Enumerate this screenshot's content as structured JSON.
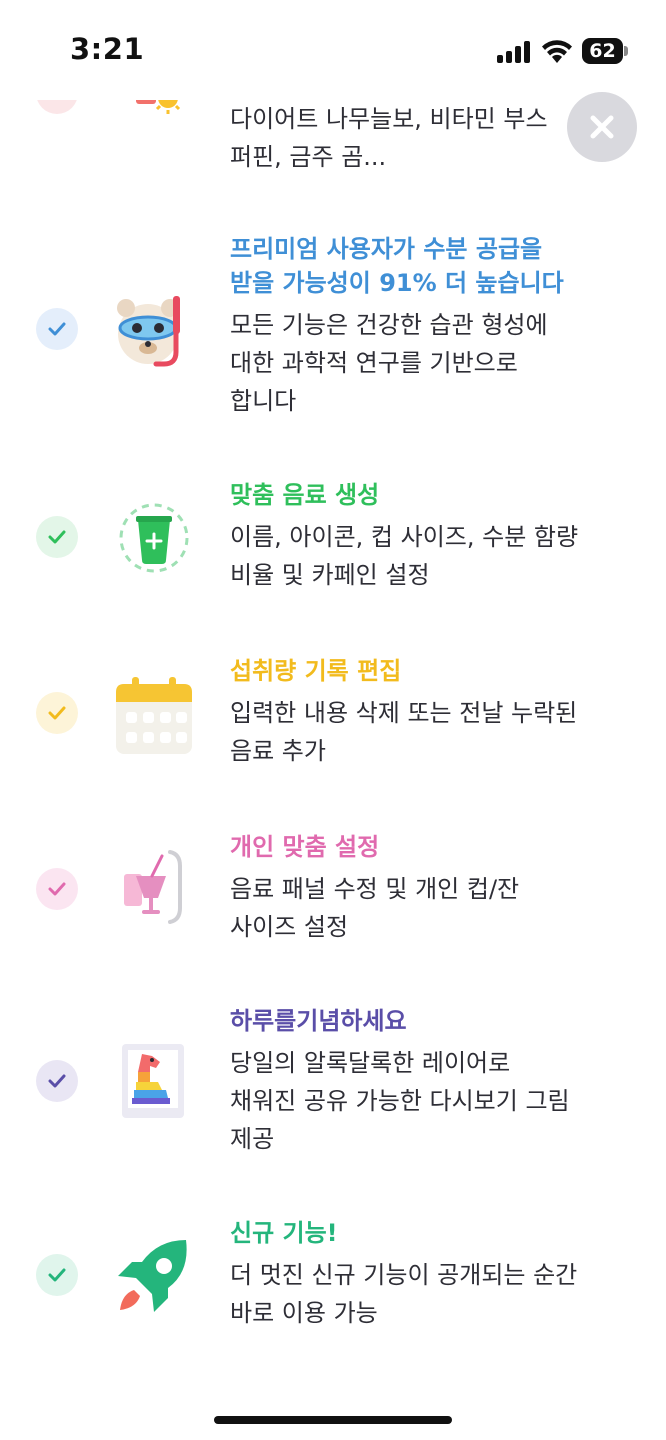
{
  "status_bar": {
    "time": "3:21",
    "battery": "62"
  },
  "partial_item": {
    "lines": [
      "다이어트 나무늘보, 비타민 부스",
      "퍼핀, 금주 곰..."
    ]
  },
  "features": [
    {
      "title_lines": [
        "프리미엄 사용자가 수분 공급을",
        "받을 가능성이 91% 더 높습니다"
      ],
      "desc_lines": [
        "모든 기능은 건강한 습관 형성에",
        "대한 과학적 연구를 기반으로",
        "합니다"
      ],
      "color": "#3f8fd6",
      "check_bg": "#e4eefb",
      "icon": "snorkel-dog-icon"
    },
    {
      "title_lines": [
        "맞춤 음료 생성"
      ],
      "desc_lines": [
        "이름, 아이콘, 컵 사이즈, 수분 함량",
        "비율 및 카페인 설정"
      ],
      "color": "#2fbf5b",
      "check_bg": "#e3f6e8",
      "icon": "custom-drink-cup-icon"
    },
    {
      "title_lines": [
        "섭취량 기록 편집"
      ],
      "desc_lines": [
        "입력한 내용 삭제 또는 전날 누락된",
        "음료 추가"
      ],
      "color": "#f2bb1d",
      "check_bg": "#fdf4d8",
      "icon": "calendar-icon"
    },
    {
      "title_lines": [
        "개인 맞춤 설정"
      ],
      "desc_lines": [
        "음료 패널 수정 및 개인 컵/잔",
        "사이즈 설정"
      ],
      "color": "#e06aae",
      "check_bg": "#fbe5f1",
      "icon": "milkshake-icon"
    },
    {
      "title_lines": [
        "하루를기념하세요"
      ],
      "desc_lines": [
        "당일의 알록달록한 레이어로",
        "채워진 공유 가능한 다시보기 그림",
        "제공"
      ],
      "color": "#5a4ea8",
      "check_bg": "#e9e6f4",
      "icon": "colorful-llama-picture-icon"
    },
    {
      "title_lines": [
        "신규 기능!"
      ],
      "desc_lines": [
        "더 멋진 신규 기능이 공개되는 순간",
        "바로 이용 가능"
      ],
      "color": "#24b57c",
      "check_bg": "#e0f5ec",
      "icon": "rocket-icon"
    }
  ]
}
